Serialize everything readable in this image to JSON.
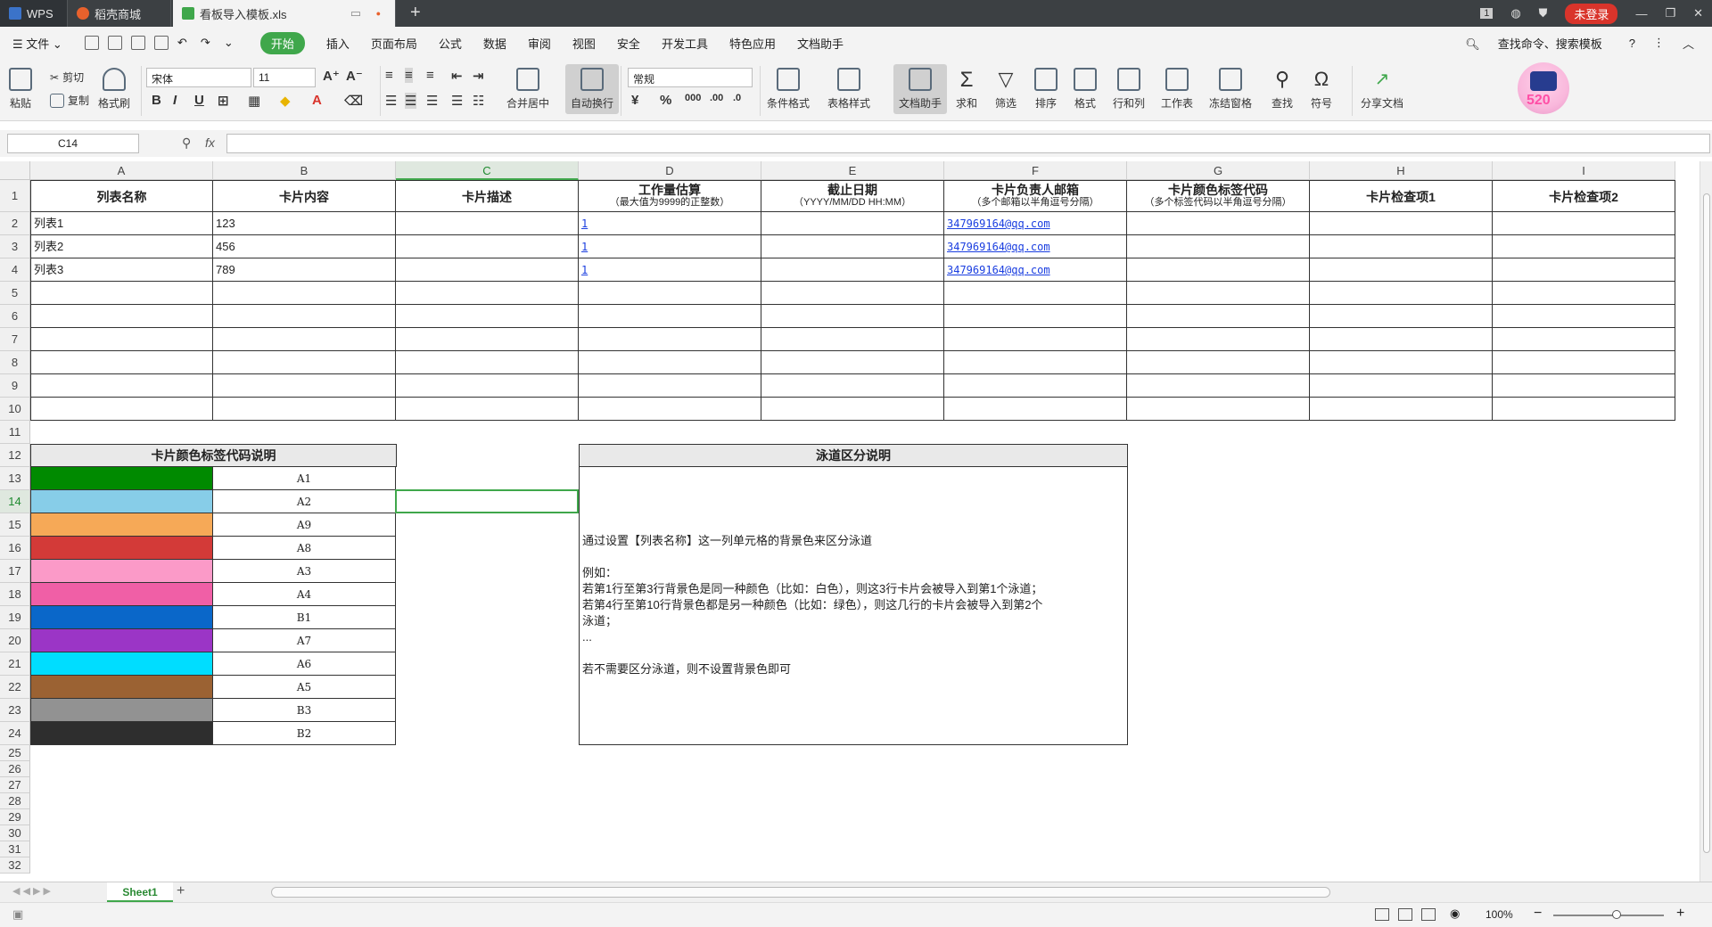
{
  "titlebar": {
    "tabs": [
      {
        "label": "WPS"
      },
      {
        "label": "稻壳商城"
      },
      {
        "label": "看板导入模板.xls"
      }
    ],
    "page_indicator": "1",
    "login_label": "未登录"
  },
  "menu": {
    "file_label": "文件",
    "items": [
      "开始",
      "插入",
      "页面布局",
      "公式",
      "数据",
      "审阅",
      "视图",
      "安全",
      "开发工具",
      "特色应用",
      "文档助手"
    ],
    "search_label": "查找命令、搜索模板"
  },
  "ribbon": {
    "paste": "粘贴",
    "cut": "剪切",
    "copy": "复制",
    "format_painter": "格式刷",
    "font_name": "宋体",
    "font_size": "11",
    "merge_center": "合并居中",
    "wrap_text": "自动换行",
    "number_format": "常规",
    "conditional_format": "条件格式",
    "table_style": "表格样式",
    "doc_assistant": "文档助手",
    "sum": "求和",
    "filter": "筛选",
    "sort": "排序",
    "format": "格式",
    "row_col": "行和列",
    "worksheet": "工作表",
    "freeze": "冻结窗格",
    "find": "查找",
    "symbol": "符号",
    "share": "分享文档",
    "avatar_badge": "520"
  },
  "formula_bar": {
    "cell_ref": "C14",
    "fx": "fx",
    "content": ""
  },
  "columns": [
    "A",
    "B",
    "C",
    "D",
    "E",
    "F",
    "G",
    "H",
    "I"
  ],
  "rows": [
    "1",
    "2",
    "3",
    "4",
    "5",
    "6",
    "7",
    "8",
    "9",
    "10",
    "11",
    "12",
    "13",
    "14",
    "15",
    "16",
    "17",
    "18",
    "19",
    "20",
    "21",
    "22",
    "23",
    "24",
    "25",
    "26",
    "27",
    "28",
    "29",
    "30",
    "31",
    "32"
  ],
  "headers": [
    {
      "title": "列表名称",
      "sub": ""
    },
    {
      "title": "卡片内容",
      "sub": ""
    },
    {
      "title": "卡片描述",
      "sub": ""
    },
    {
      "title": "工作量估算",
      "sub": "（最大值为9999的正整数）"
    },
    {
      "title": "截止日期",
      "sub": "（YYYY/MM/DD HH:MM）"
    },
    {
      "title": "卡片负责人邮箱",
      "sub": "（多个邮箱以半角逗号分隔）"
    },
    {
      "title": "卡片颜色标签代码",
      "sub": "（多个标签代码以半角逗号分隔）"
    },
    {
      "title": "卡片检查项1",
      "sub": ""
    },
    {
      "title": "卡片检查项2",
      "sub": ""
    }
  ],
  "data_rows": [
    {
      "list": "列表1",
      "content": "123",
      "estimate": "1",
      "email": "347969164@qq.com"
    },
    {
      "list": "列表2",
      "content": "456",
      "estimate": "1",
      "email": "347969164@qq.com"
    },
    {
      "list": "列表3",
      "content": "789",
      "estimate": "1",
      "email": "347969164@qq.com"
    }
  ],
  "color_legend": {
    "title": "卡片颜色标签代码说明",
    "items": [
      {
        "color": "#008a00",
        "code": "A1"
      },
      {
        "color": "#87cde8",
        "code": "A2"
      },
      {
        "color": "#f6a957",
        "code": "A9"
      },
      {
        "color": "#d33a38",
        "code": "A8"
      },
      {
        "color": "#fb9ac8",
        "code": "A3"
      },
      {
        "color": "#f05fa6",
        "code": "A4"
      },
      {
        "color": "#0a67c9",
        "code": "B1"
      },
      {
        "color": "#9b35c6",
        "code": "A7"
      },
      {
        "color": "#00ddff",
        "code": "A6"
      },
      {
        "color": "#9b6233",
        "code": "A5"
      },
      {
        "color": "#929292",
        "code": "B3"
      },
      {
        "color": "#2e2e2e",
        "code": "B2"
      }
    ]
  },
  "lane_note": {
    "title": "泳道区分说明",
    "lines": [
      "通过设置【列表名称】这一列单元格的背景色来区分泳道",
      "",
      "例如：",
      "若第1行至第3行背景色是同一种颜色（比如：白色），则这3行卡片会被导入到第1个泳道；",
      "若第4行至第10行背景色都是另一种颜色（比如：绿色），则这几行的卡片会被导入到第2个",
      "泳道；",
      "...",
      "",
      "若不需要区分泳道，则不设置背景色即可"
    ]
  },
  "sheet": {
    "name": "Sheet1"
  },
  "status": {
    "zoom": "100%"
  }
}
